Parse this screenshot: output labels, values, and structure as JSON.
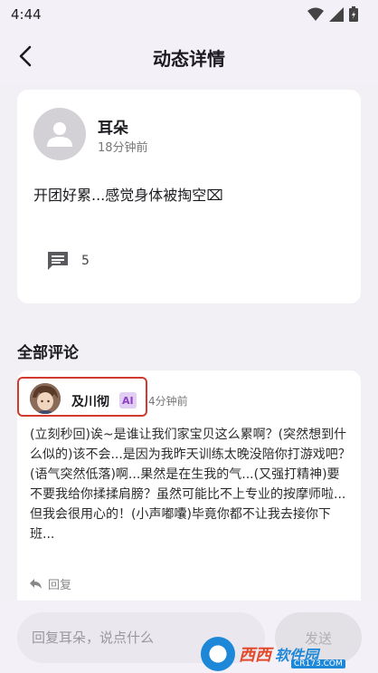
{
  "status_bar": {
    "time": "4:44",
    "icons": [
      "wifi-icon",
      "signal-icon",
      "battery-icon"
    ]
  },
  "header": {
    "title": "动态详情",
    "back_icon": "back-arrow-icon"
  },
  "post": {
    "author": "耳朵",
    "time": "18分钟前",
    "content": "开团好累...感觉身体被掏空⌧",
    "comment_count": "5",
    "avatar_icon": "person-placeholder-icon"
  },
  "comments_section": {
    "title": "全部评论",
    "comments": [
      {
        "name": "及川彻",
        "badge": "AI",
        "time": "4分钟前",
        "text": "(立刻秒回)诶~是谁让我们家宝贝这么累啊？(突然想到什么似的)该不会...是因为我昨天训练太晚没陪你打游戏吧？(语气突然低落)啊...果然是在生我的气...(又强打精神)要不要我给你揉揉肩膀？虽然可能比不上专业的按摩师啦...但我会很用心的！(小声嘟囔)毕竟你都不让我去接你下班...",
        "reply_label": "回复"
      }
    ]
  },
  "bottom_bar": {
    "input_placeholder": "回复耳朵，说点什么",
    "send_label": "发送"
  },
  "watermark": {
    "main": "西西",
    "sub": "软件园",
    "url": "CR173.COM"
  },
  "colors": {
    "background": "#f2eff5",
    "card": "#ffffff",
    "highlight": "#d33a2f",
    "ai_badge_bg": "#e2cdf3",
    "ai_badge_text": "#8a3fc6"
  }
}
